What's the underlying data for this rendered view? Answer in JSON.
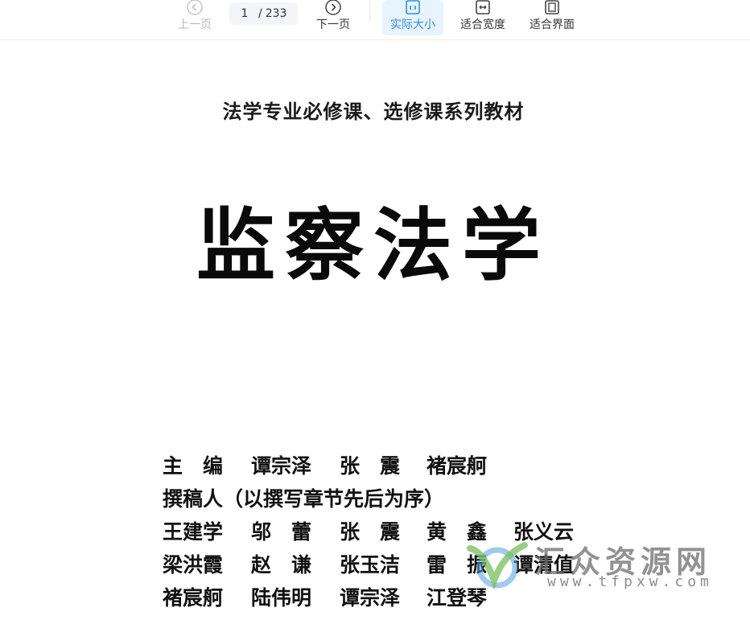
{
  "toolbar": {
    "prev_label": "上一页",
    "next_label": "下一页",
    "current_page": "1",
    "page_separator": "/",
    "total_pages": "233",
    "actual_size_label": "实际大小",
    "fit_width_label": "适合宽度",
    "fit_screen_label": "适合界面",
    "active_color": "#2f8fe8",
    "icons": {
      "prev": "chevron-left-circle-icon",
      "next": "chevron-right-circle-icon",
      "actual": "actual-size-icon",
      "width": "fit-width-icon",
      "fit": "fit-screen-icon"
    }
  },
  "document": {
    "series": "法学专业必修课、选修课系列教材",
    "title": "监察法学",
    "credits": [
      [
        "主　编",
        "谭宗泽",
        "张　震",
        "褚宸舸"
      ],
      [
        "撰稿人（以撰写章节先后为序）"
      ],
      [
        "王建学",
        "邬　蕾",
        "张　震",
        "黄　鑫",
        "张义云"
      ],
      [
        "梁洪霞",
        "赵　谦",
        "张玉洁",
        "雷　振",
        "谭清值"
      ],
      [
        "褚宸舸",
        "陆伟明",
        "谭宗泽",
        "江登琴"
      ]
    ]
  },
  "watermark": {
    "name": "汇众资源网",
    "url": "www.tfpxw.com"
  }
}
